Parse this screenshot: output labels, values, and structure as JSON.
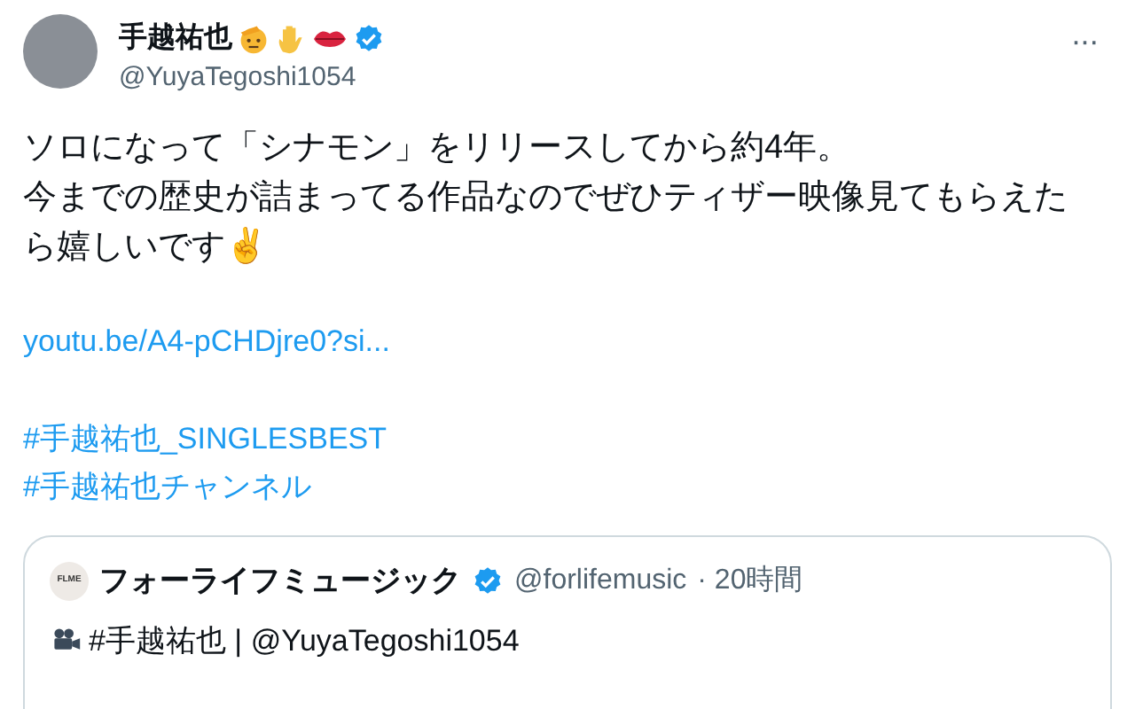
{
  "author": {
    "name": "手越祐也",
    "handle": "@YuyaTegoshi1054",
    "verified": true
  },
  "more": "···",
  "body": [
    "ソロになって「シナモン」をリリースしてから約4年。",
    "今までの歴史が詰まってる作品なのでぜひティザー映像見てもらえたら嬉しいです✌"
  ],
  "link": "youtu.be/A4-pCHDjre0?si...",
  "hashtags": [
    "#手越祐也_SINGLESBEST",
    "#手越祐也チャンネル"
  ],
  "quote": {
    "avatar_text": "FLME",
    "name": "フォーライフミュージック",
    "verified": true,
    "handle": "@forlifemusic",
    "time": "· 20時間",
    "text": "#手越祐也 | @YuyaTegoshi1054"
  }
}
